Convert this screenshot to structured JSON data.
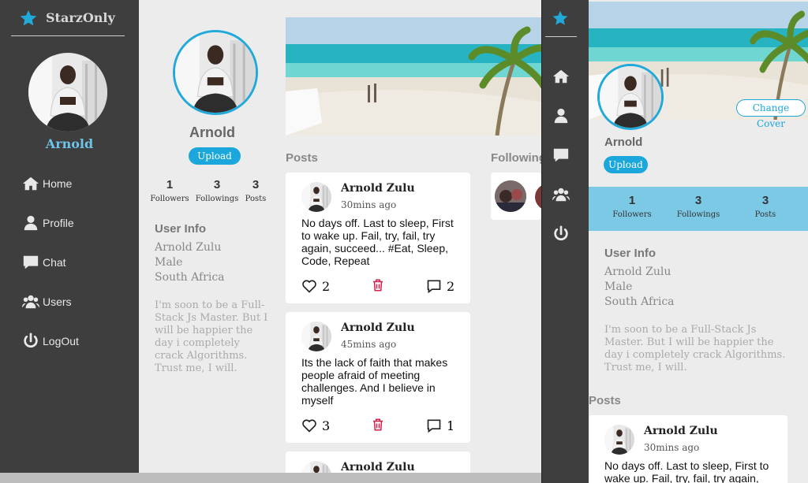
{
  "brand": {
    "name": "StarzOnly"
  },
  "sidebar": {
    "user_name": "Arnold",
    "items": [
      {
        "label": "Home",
        "icon": "home-icon"
      },
      {
        "label": "Profile",
        "icon": "user-icon"
      },
      {
        "label": "Chat",
        "icon": "chat-icon"
      },
      {
        "label": "Users",
        "icon": "users-icon"
      },
      {
        "label": "LogOut",
        "icon": "power-icon"
      }
    ]
  },
  "profile": {
    "name": "Arnold",
    "upload_label": "Upload",
    "stats": [
      {
        "value": "1",
        "label": "Followers"
      },
      {
        "value": "3",
        "label": "Followings"
      },
      {
        "value": "3",
        "label": "Posts"
      }
    ],
    "user_info_title": "User Info",
    "full_name": "Arnold Zulu",
    "gender": "Male",
    "country": "South Africa",
    "bio": "I'm soon to be a Full-Stack Js Master. But I will be happier the day i completely crack Algorithms. Trust me, I will."
  },
  "posts": {
    "title": "Posts",
    "items": [
      {
        "author": "Arnold Zulu",
        "time": "30mins ago",
        "text": "No days off. Last to sleep, First to wake up. Fail, try, fail, try again, succeed... #Eat, Sleep, Code, Repeat",
        "likes": "2",
        "comments": "2"
      },
      {
        "author": "Arnold Zulu",
        "time": "45mins ago",
        "text": "Its the lack of faith that makes people afraid of meeting challenges. And I believe in myself",
        "likes": "3",
        "comments": "1"
      },
      {
        "author": "Arnold Zulu",
        "time": "",
        "text": "",
        "likes": "",
        "comments": ""
      }
    ]
  },
  "following": {
    "title": "Following"
  },
  "mobile": {
    "change_cover_label": "Change Cover",
    "name": "Arnold",
    "upload_label": "Upload",
    "stats": [
      {
        "value": "1",
        "label": "Followers"
      },
      {
        "value": "3",
        "label": "Followings"
      },
      {
        "value": "3",
        "label": "Posts"
      }
    ],
    "user_info_title": "User Info",
    "full_name": "Arnold Zulu",
    "gender": "Male",
    "country": "South Africa",
    "bio": "I'm soon to be a Full-Stack Js Master. But I will be happier the day i completely crack Algorithms. Trust me, I will.",
    "posts_title": "Posts",
    "post": {
      "author": "Arnold Zulu",
      "time": "30mins ago",
      "text": "No days off. Last to sleep, First to wake up. Fail, try, fail, try again,"
    }
  },
  "colors": {
    "accent": "#1ba7dc",
    "sidebar": "#3e3e3e",
    "name_accent": "#6ec3e8",
    "delete": "#d0204a"
  }
}
